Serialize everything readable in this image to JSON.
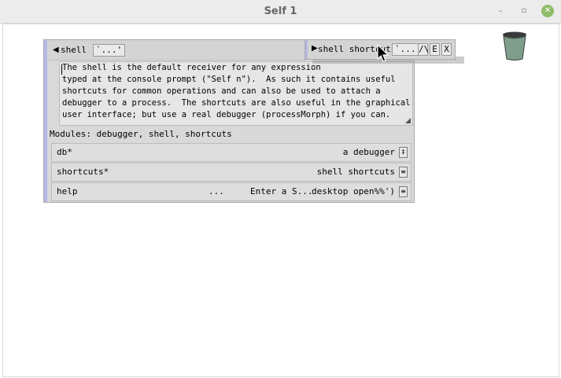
{
  "window": {
    "title": "Self 1",
    "min_glyph": "–",
    "max_glyph": "▫",
    "close_glyph": "✕"
  },
  "outliner": {
    "triangle": "◀",
    "name": "shell",
    "ellipsis": "`...'",
    "comment_lines": [
      "The shell is the default receiver for any expression",
      "typed at the console prompt (\"Self n\").  As such it contains useful",
      "shortcuts for common operations and can also be used to attach a",
      "debugger to a process.  The shortcuts are also useful in the graphical",
      "user interface; but use a real debugger (processMorph) if you can."
    ],
    "modules": "Modules:  debugger, shell, shortcuts",
    "slots": [
      {
        "name": "db*",
        "value": "a debugger",
        "icon": "‡"
      },
      {
        "name": "shortcuts*",
        "value": "shell shortcuts",
        "icon": "≡"
      },
      {
        "name": "help",
        "dots": "...",
        "string": "Enter a S...",
        "value": "desktop open%%')",
        "icon": "≡"
      }
    ]
  },
  "shortcuts_outliner": {
    "triangle": "▶",
    "name": "shell shortcuts",
    "ellipsis": "`...'",
    "btn_up": "/\\",
    "btn_e": "E",
    "btn_x": "X"
  },
  "colors": {
    "accent_bar": "#b7b7e6",
    "panel": "#d9d9d9",
    "close": "#8fbc6a"
  }
}
